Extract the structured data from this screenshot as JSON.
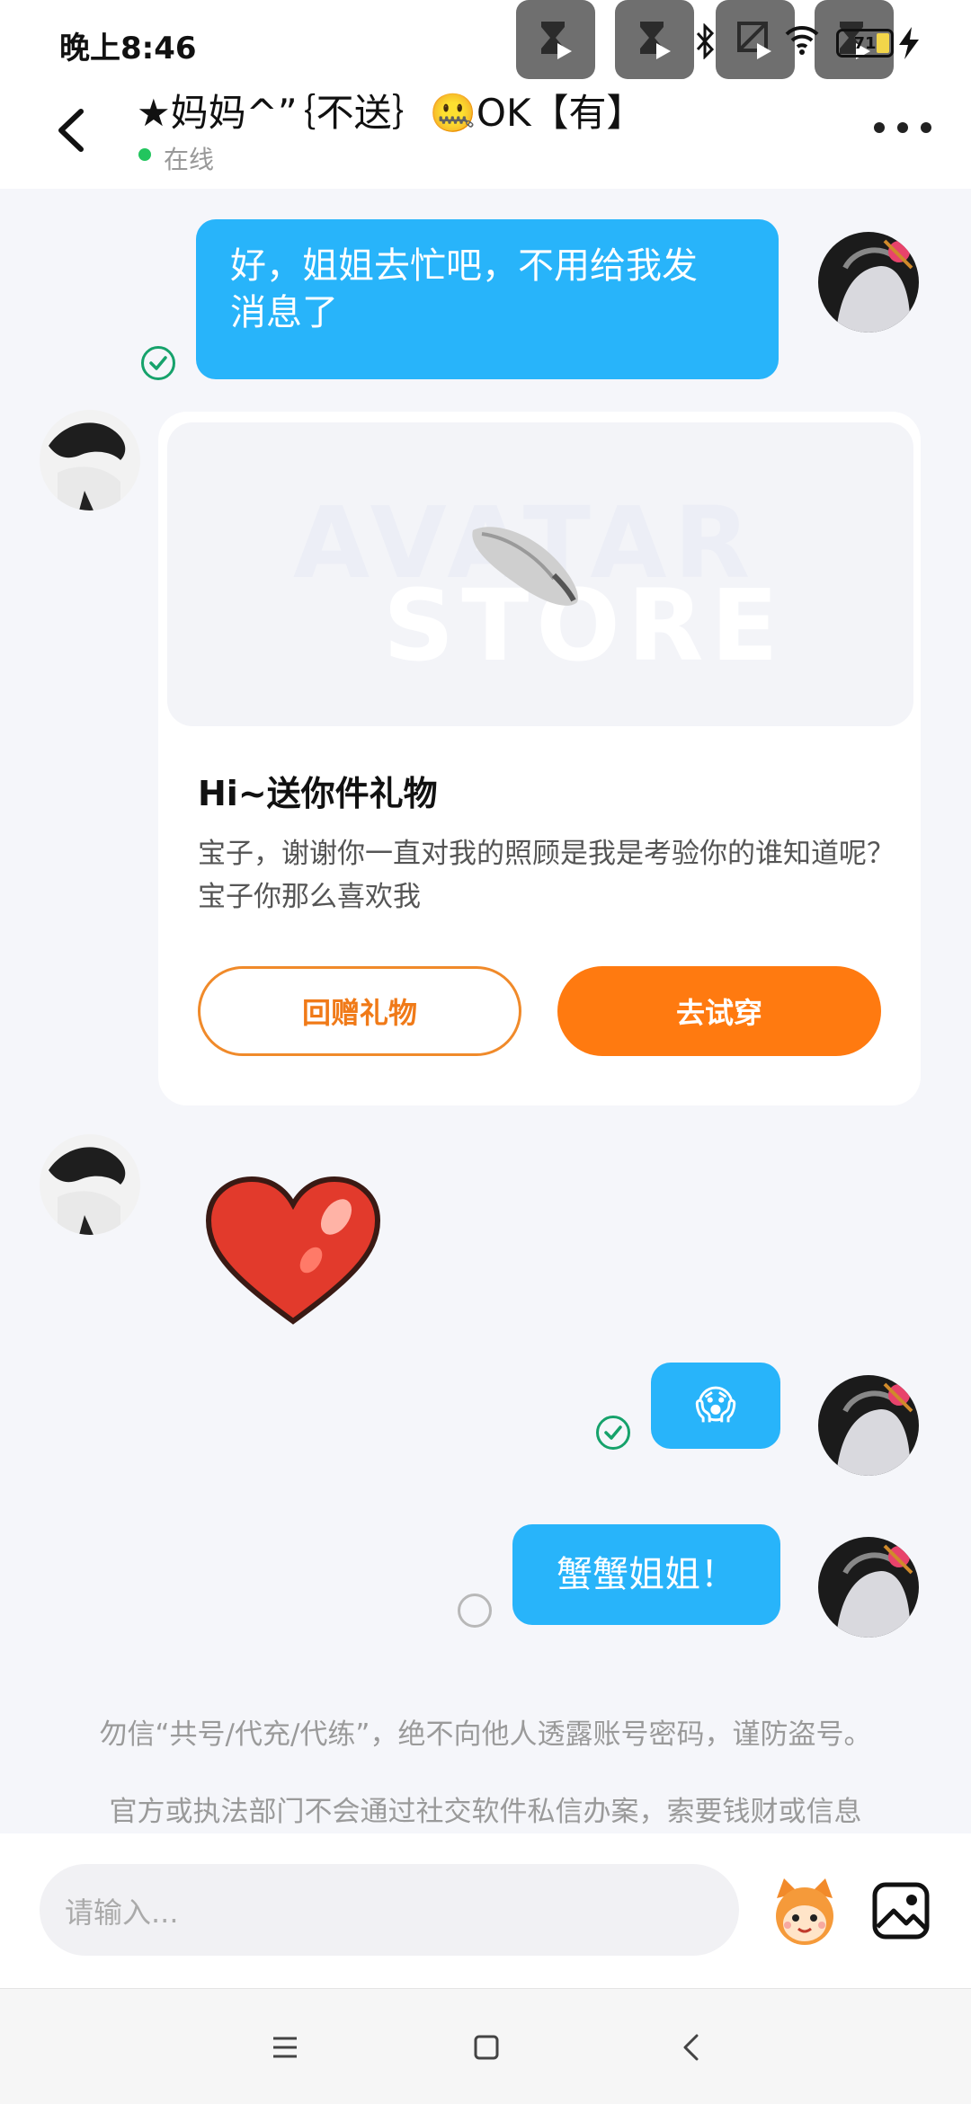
{
  "status_bar": {
    "time": "晚上8:46",
    "battery_level": "71",
    "icons": [
      "media-notification-icon",
      "media-notification-icon",
      "media-notification-icon",
      "media-notification-icon",
      "bluetooth-icon",
      "wifi-icon",
      "battery-icon",
      "charging-icon"
    ]
  },
  "header": {
    "title": "★妈妈^”｛不送｝🤐OK【有】",
    "status": "在线"
  },
  "messages": [
    {
      "side": "right",
      "type": "text",
      "text": "好，姐姐去忙吧，不用给我发\n消息了",
      "state": "read"
    },
    {
      "side": "left",
      "type": "gift_card",
      "watermark": [
        "AVATAR",
        "STORE"
      ],
      "title": "Hi~送你件礼物",
      "body": "宝子，谢谢你一直对我的照顾是我是考验你的谁知道呢？宝子你那么喜欢我",
      "button_secondary": "回赠礼物",
      "button_primary": "去试穿"
    },
    {
      "side": "left",
      "type": "sticker",
      "sticker": "red-heart"
    },
    {
      "side": "right",
      "type": "emoji",
      "emoji": "😱",
      "state": "read"
    },
    {
      "side": "right",
      "type": "text",
      "text": "蟹蟹姐姐！",
      "state": "sending"
    }
  ],
  "notices": [
    "勿信“共号/代充/代练”，绝不向他人透露账号密码，谨防盗号。",
    "官方或执法部门不会通过社交软件私信办案，索要钱财或信息"
  ],
  "input": {
    "placeholder": "请输入..."
  },
  "colors": {
    "bubble_blue": "#28b4fa",
    "accent_orange": "#ff7a10",
    "online_green": "#22c55e",
    "read_green": "#16a26b"
  }
}
